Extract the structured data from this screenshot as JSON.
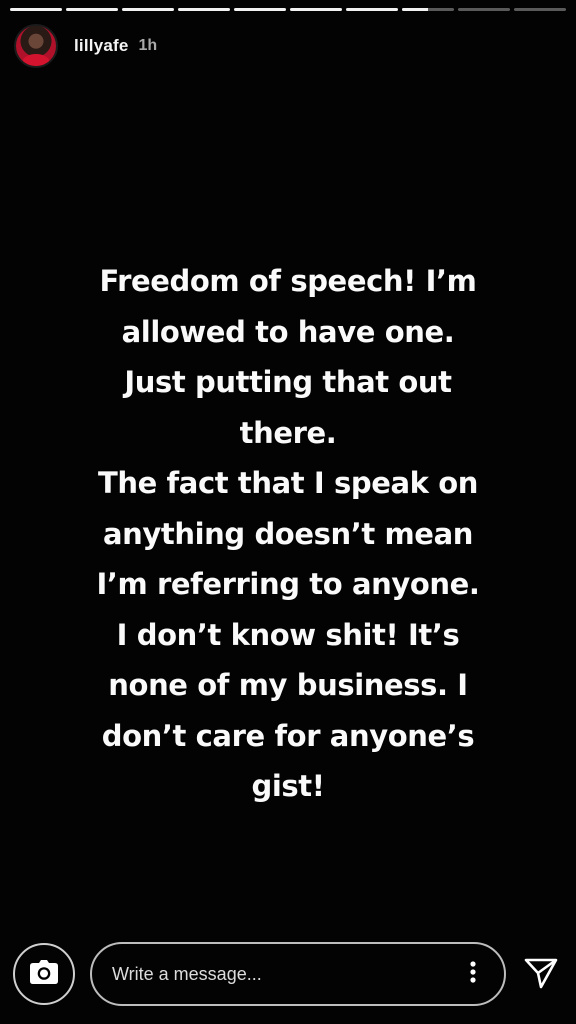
{
  "story": {
    "segments_total": 10,
    "segments_completed": 7,
    "current_segment_fraction": 0.5,
    "user": {
      "username": "lillyafe",
      "time_ago": "1h"
    },
    "text": "Freedom of speech! I’m\nallowed to have one.\nJust putting that out\nthere.\nThe fact that I speak on\nanything doesn’t mean\nI’m referring to anyone.\nI don’t know shit! It’s\nnone of my business. I\ndon’t care for anyone’s\ngist!"
  },
  "footer": {
    "message_placeholder": "Write a message...",
    "icons": {
      "camera": "camera-icon",
      "more": "more-vertical-icon",
      "send": "send-icon"
    }
  },
  "colors": {
    "background": "#030303",
    "text": "#fafafa",
    "progress_track": "rgba(255,255,255,0.35)",
    "progress_fill": "#f2f2f2"
  }
}
